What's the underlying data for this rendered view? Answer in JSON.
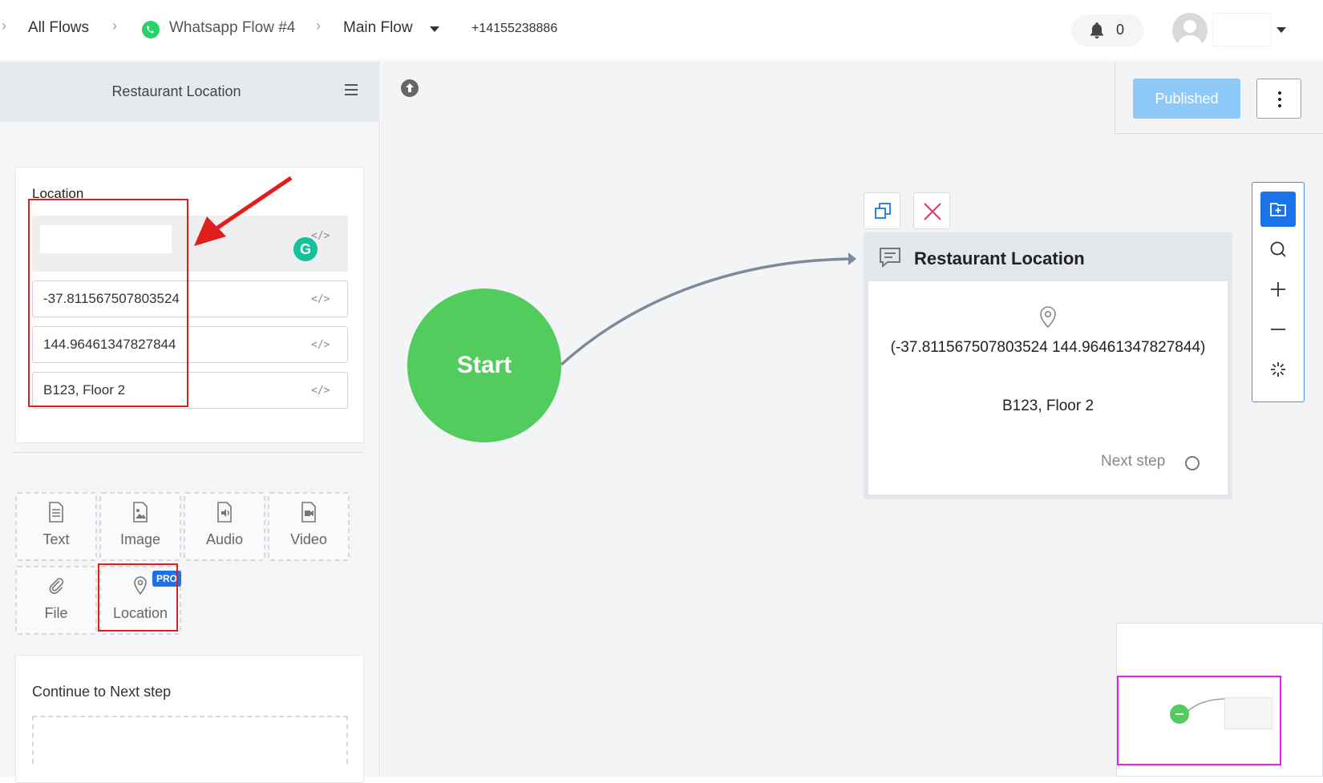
{
  "breadcrumb": {
    "all_flows": "All Flows",
    "flow_name": "Whatsapp Flow #4",
    "sub_flow": "Main Flow",
    "phone": "+14155238886"
  },
  "header": {
    "notification_count": "0"
  },
  "left_panel": {
    "title": "Restaurant Location",
    "location_card": {
      "label": "Location",
      "name_value": "",
      "latitude": "-37.811567507803524",
      "longitude": "144.96461347827844",
      "address": "B123, Floor 2"
    },
    "tools": [
      {
        "label": "Text",
        "icon": "text-file-icon"
      },
      {
        "label": "Image",
        "icon": "image-icon"
      },
      {
        "label": "Audio",
        "icon": "audio-icon"
      },
      {
        "label": "Video",
        "icon": "video-icon"
      },
      {
        "label": "File",
        "icon": "paperclip-icon"
      },
      {
        "label": "Location",
        "icon": "location-pin-icon",
        "badge": "PRO"
      }
    ],
    "next_step_label": "Continue to Next step"
  },
  "toolbar": {
    "publish_label": "Published"
  },
  "canvas": {
    "start_label": "Start",
    "node": {
      "title": "Restaurant Location",
      "coords": "(-37.811567507803524 144.96461347827844)",
      "address": "B123, Floor 2",
      "next_step": "Next step"
    }
  },
  "colors": {
    "accent": "#1a73e8",
    "start_green": "#52cc5c",
    "publish_disabled": "#8ec9f7",
    "highlight_red": "#e21d1d",
    "minimap_frame": "#e91ee9"
  }
}
